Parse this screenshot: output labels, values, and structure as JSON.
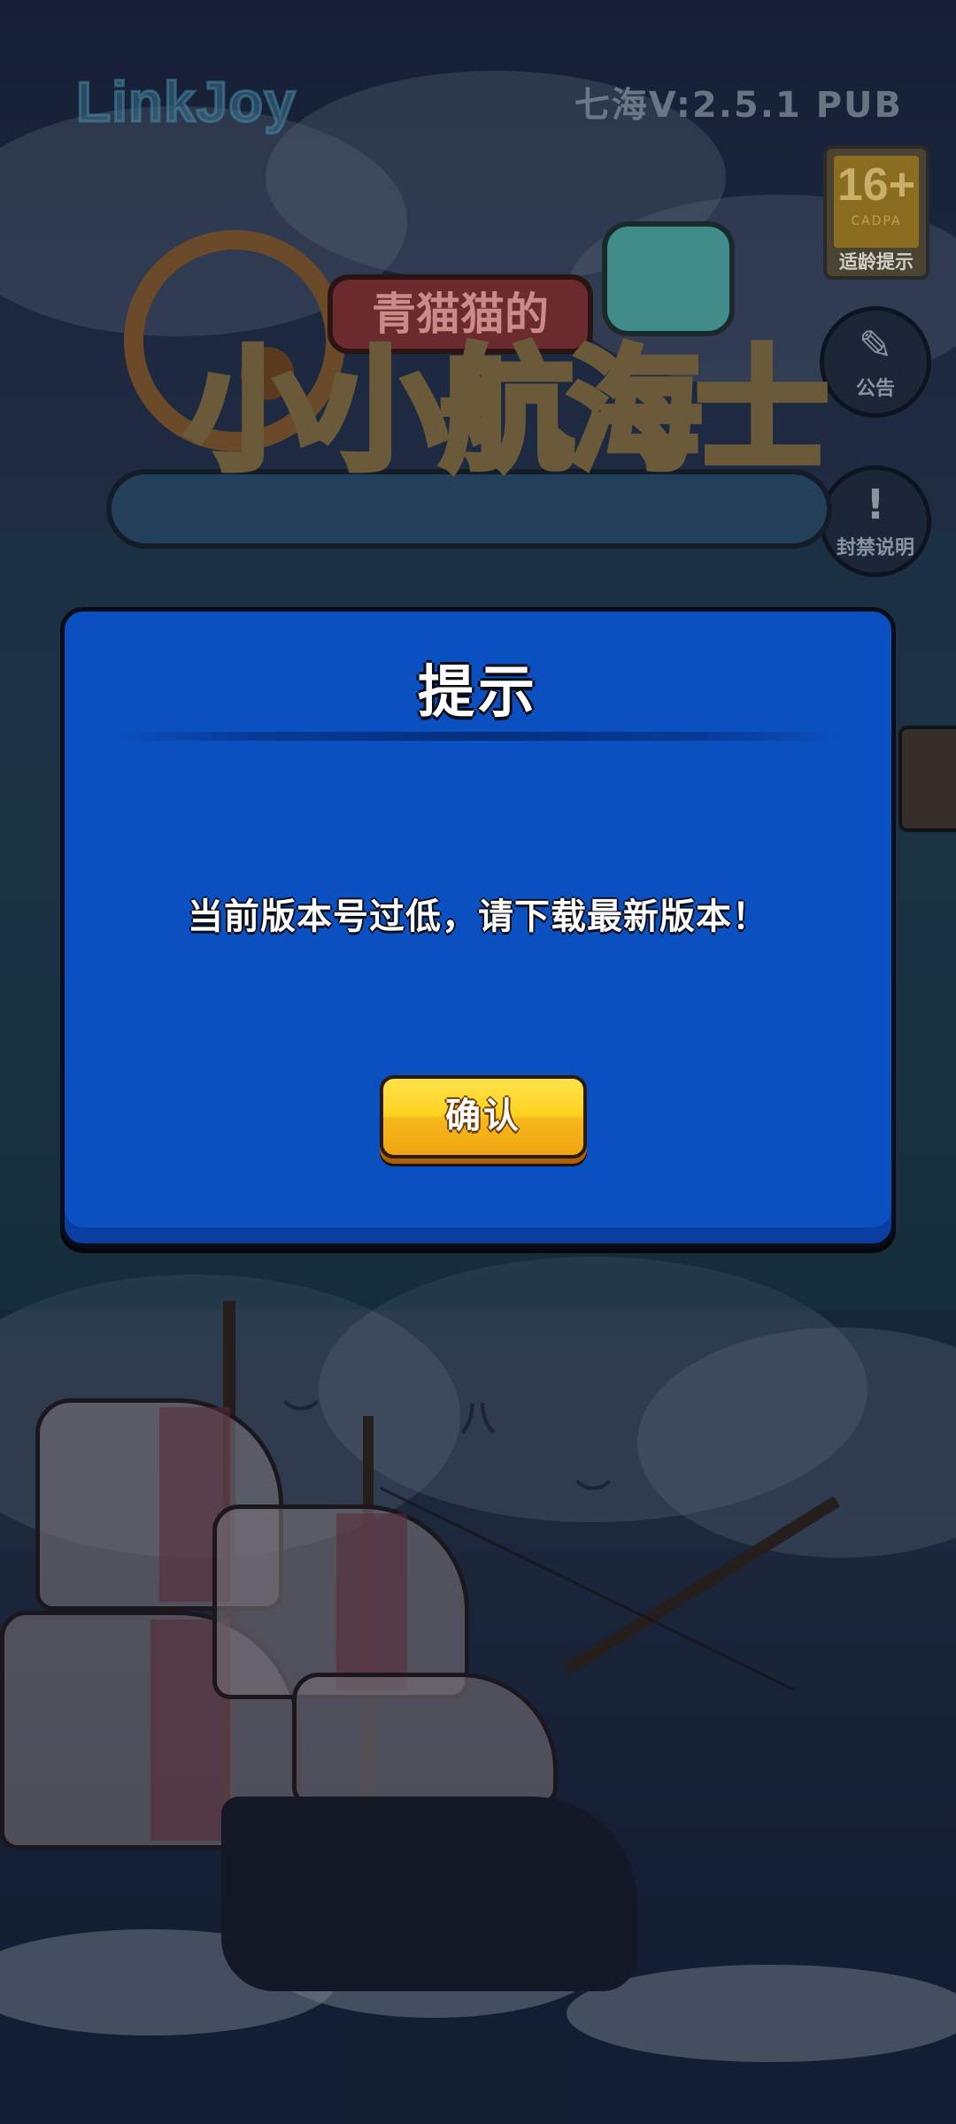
{
  "header": {
    "brand_logo": "LinkJoy",
    "version": "七海V:2.5.1  PUB"
  },
  "side_buttons": {
    "age_rating": {
      "number": "16+",
      "org": "CADPA",
      "caption": "适龄提示"
    },
    "notice": {
      "icon": "edit-note-icon",
      "label": "公告"
    },
    "ban_info": {
      "icon": "warning-icon",
      "label": "封禁说明"
    }
  },
  "game_logo": {
    "subtitle": "青猫猫的",
    "title": "小小航海士"
  },
  "dialog": {
    "title": "提示",
    "message": "当前版本号过低，请下载最新版本！",
    "confirm_label": "确认"
  },
  "colors": {
    "dialog_bg": "#0b50c0",
    "button_yellow": "#ffd21f"
  }
}
